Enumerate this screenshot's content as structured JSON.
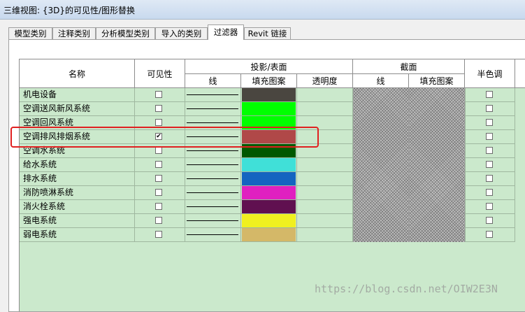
{
  "window": {
    "title": "三维视图: {3D}的可见性/图形替换"
  },
  "tabs": [
    {
      "label": "模型类别",
      "active": false
    },
    {
      "label": "注释类别",
      "active": false
    },
    {
      "label": "分析模型类别",
      "active": false
    },
    {
      "label": "导入的类别",
      "active": false
    },
    {
      "label": "过滤器",
      "active": true
    },
    {
      "label": "Revit 链接",
      "active": false
    }
  ],
  "table": {
    "headers": {
      "name": "名称",
      "visibility": "可见性",
      "projection_group": "投影/表面",
      "projection_lines": "线",
      "projection_pattern": "填充图案",
      "projection_transparency": "透明度",
      "cut_group": "截面",
      "cut_lines": "线",
      "cut_pattern": "填充图案",
      "halftone": "半色调"
    },
    "rows": [
      {
        "name": "机电设备",
        "visible": false,
        "pattern_color": "#4a4640",
        "halftone": false
      },
      {
        "name": "空调送风新风系统",
        "visible": false,
        "pattern_color": "#00ff00",
        "halftone": false
      },
      {
        "name": "空调回风系统",
        "visible": false,
        "pattern_color": "#00ff00",
        "halftone": false
      },
      {
        "name": "空调排风排烟系统",
        "visible": true,
        "pattern_color": "#b04848",
        "halftone": false
      },
      {
        "name": "空调水系统",
        "visible": false,
        "pattern_color": "#005800",
        "halftone": false
      },
      {
        "name": "给水系统",
        "visible": false,
        "pattern_color": "#40e0d8",
        "halftone": false
      },
      {
        "name": "排水系统",
        "visible": false,
        "pattern_color": "#1464c0",
        "halftone": false
      },
      {
        "name": "消防喷淋系统",
        "visible": false,
        "pattern_color": "#e020c0",
        "halftone": false
      },
      {
        "name": "消火栓系统",
        "visible": false,
        "pattern_color": "#601050",
        "halftone": false
      },
      {
        "name": "强电系统",
        "visible": false,
        "pattern_color": "#f0f020",
        "halftone": false
      },
      {
        "name": "弱电系统",
        "visible": false,
        "pattern_color": "#d4b868",
        "halftone": false
      }
    ]
  },
  "watermark": "https://blog.csdn.net/OIW2E3N",
  "colors": {
    "row_background": "#cbe9cc",
    "highlight_border": "#e02020"
  }
}
